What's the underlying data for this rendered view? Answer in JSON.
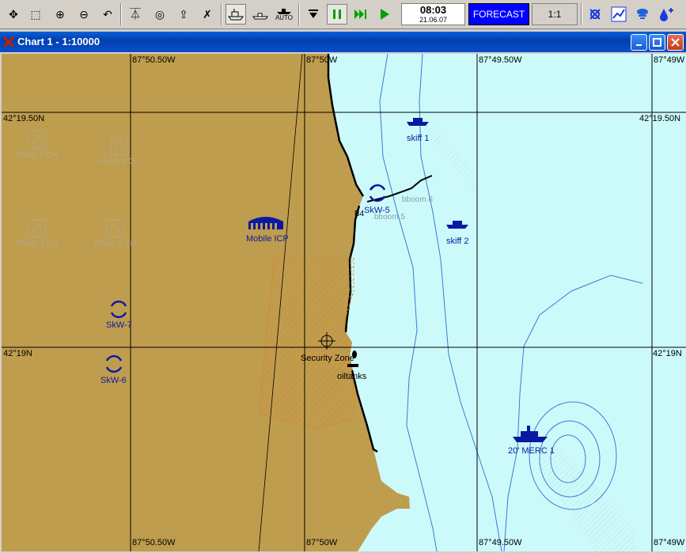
{
  "toolbar": {
    "buttons": [
      {
        "name": "pan-icon",
        "glyph": "✥"
      },
      {
        "name": "select-zoom-icon",
        "glyph": "⬚"
      },
      {
        "name": "zoom-in-icon",
        "glyph": "⊕"
      },
      {
        "name": "zoom-out-icon",
        "glyph": "⊖"
      },
      {
        "name": "undo-icon",
        "glyph": "↶"
      },
      {
        "name": "compass-icon",
        "glyph": "⏄"
      },
      {
        "name": "target-icon",
        "glyph": "◎"
      },
      {
        "name": "export-icon",
        "glyph": "⇪"
      },
      {
        "name": "delete-icon",
        "glyph": "✗"
      }
    ],
    "auto_label": "AUTO",
    "clock_time": "08:03",
    "clock_date": "21.06.07",
    "forecast_label": "FORECAST",
    "scale_label": "1:1",
    "accent_forecast": "#0000ff"
  },
  "window": {
    "title": "Chart 1 - 1:10000"
  },
  "map": {
    "colors": {
      "land": "#bf9d4e",
      "water": "#ccfafa",
      "grid": "#000000",
      "depth": "#3a7ad8",
      "symbols": "#0a1aa0"
    },
    "grid_labels": {
      "top": [
        "87°50.50W",
        "87°50W",
        "87°49.50W",
        "87°49W"
      ],
      "bottom": [
        "87°50.50W",
        "87°50W",
        "87°49.50W",
        "87°49W"
      ],
      "left": [
        "42°19.50N",
        "42°19N"
      ],
      "right": [
        "42°19.50N",
        "42°19N"
      ]
    },
    "symbols": {
      "frac2": "FRAC 2 CH",
      "frac5": "FRAC 5 CH",
      "frac3": "FRAC 3 CH",
      "frac1": "FRAC 1 CH",
      "mobile_icp": "Mobile ICP",
      "skw5": "SkW-5",
      "skw7": "SkW-7",
      "skw6": "SkW-6",
      "skiff1": "skiff 1",
      "skiff2": "skiff 2",
      "boom6": "bboom.6",
      "boom5": "bboom.5",
      "b4": "B4",
      "security_zone": "Security Zone",
      "oiltanks": "oiltanks",
      "merc": "20' MERC 1"
    }
  }
}
